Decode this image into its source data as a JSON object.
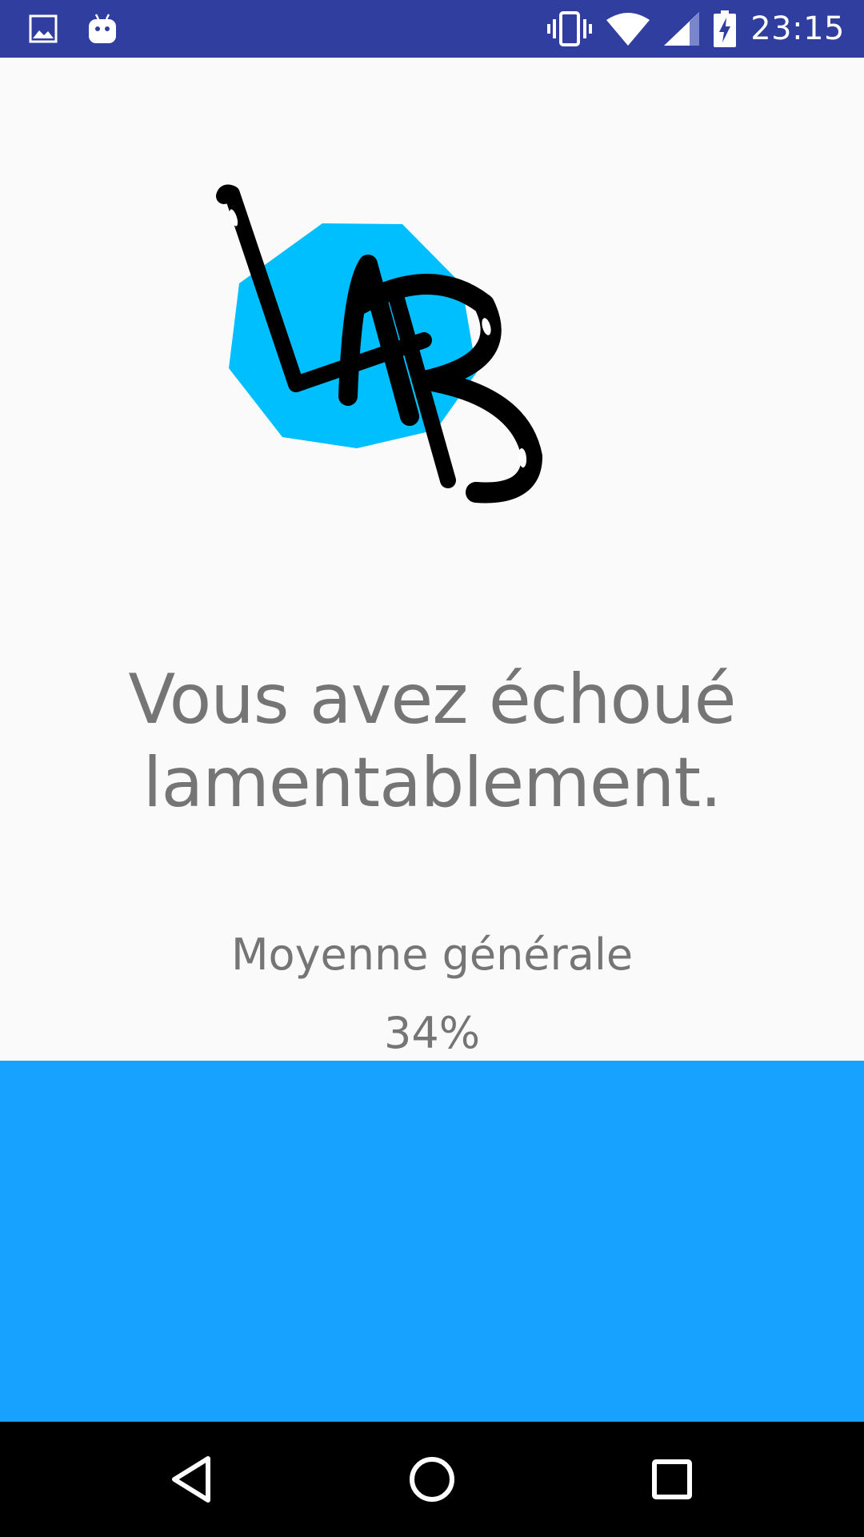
{
  "status_bar": {
    "time": "23:15",
    "left_icons": [
      "image-notification-icon",
      "android-notification-icon"
    ],
    "right_icons": [
      "vibrate-icon",
      "wifi-icon",
      "signal-icon",
      "battery-charging-icon"
    ],
    "background": "#303f9f"
  },
  "logo": {
    "text": "LAB",
    "badge_color": "#00bfff"
  },
  "result": {
    "message": "Vous avez échoué lamentablement.",
    "average_label": "Moyenne générale",
    "average_value": "34%",
    "text_color": "#757575"
  },
  "panel": {
    "color": "#18a2ff"
  },
  "navigation": {
    "buttons": [
      "back-icon",
      "home-icon",
      "recents-icon"
    ]
  }
}
